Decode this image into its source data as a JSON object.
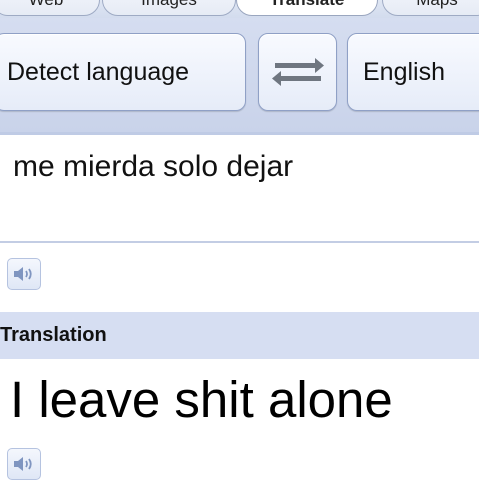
{
  "tabs": [
    {
      "label": "Web"
    },
    {
      "label": "Images"
    },
    {
      "label": "Translate"
    },
    {
      "label": "Maps"
    }
  ],
  "language_bar": {
    "source_language": "Detect language",
    "target_language": "English",
    "swap_icon": "swap-arrows-icon"
  },
  "source": {
    "text": "me mierda solo dejar",
    "speaker_icon": "speaker-icon"
  },
  "translation": {
    "header": "Translation",
    "text": "I leave shit alone",
    "speaker_icon": "speaker-icon"
  },
  "colors": {
    "bar_background": "#cfd8ee",
    "button_border": "#8fa0c6",
    "header_background": "#d6def2"
  }
}
